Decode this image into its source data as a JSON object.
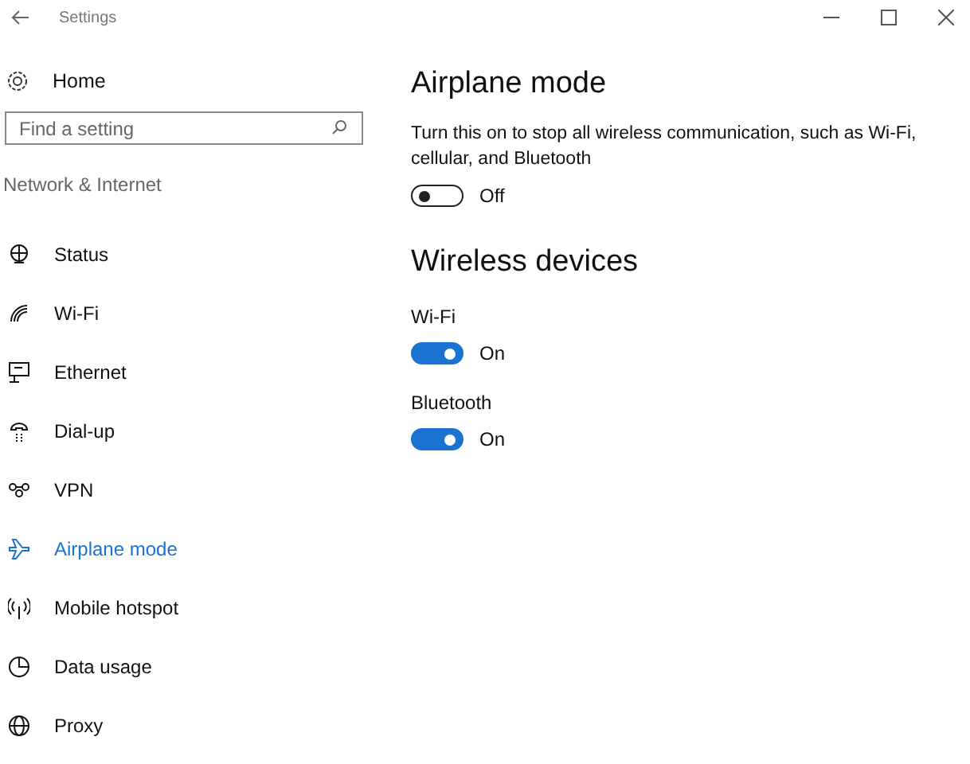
{
  "window": {
    "title": "Settings"
  },
  "sidebar": {
    "home": "Home",
    "search": {
      "placeholder": "Find a setting"
    },
    "section": "Network & Internet",
    "items": [
      {
        "label": "Status",
        "selected": false
      },
      {
        "label": "Wi-Fi",
        "selected": false
      },
      {
        "label": "Ethernet",
        "selected": false
      },
      {
        "label": "Dial-up",
        "selected": false
      },
      {
        "label": "VPN",
        "selected": false
      },
      {
        "label": "Airplane mode",
        "selected": true
      },
      {
        "label": "Mobile hotspot",
        "selected": false
      },
      {
        "label": "Data usage",
        "selected": false
      },
      {
        "label": "Proxy",
        "selected": false
      }
    ]
  },
  "airplane": {
    "title": "Airplane mode",
    "description": "Turn this on to stop all wireless communication, such as Wi-Fi, cellular, and Bluetooth",
    "toggle": {
      "on": false,
      "state": "Off"
    }
  },
  "wireless": {
    "title": "Wireless devices",
    "devices": [
      {
        "label": "Wi-Fi",
        "on": true,
        "state": "On"
      },
      {
        "label": "Bluetooth",
        "on": true,
        "state": "On"
      }
    ]
  }
}
